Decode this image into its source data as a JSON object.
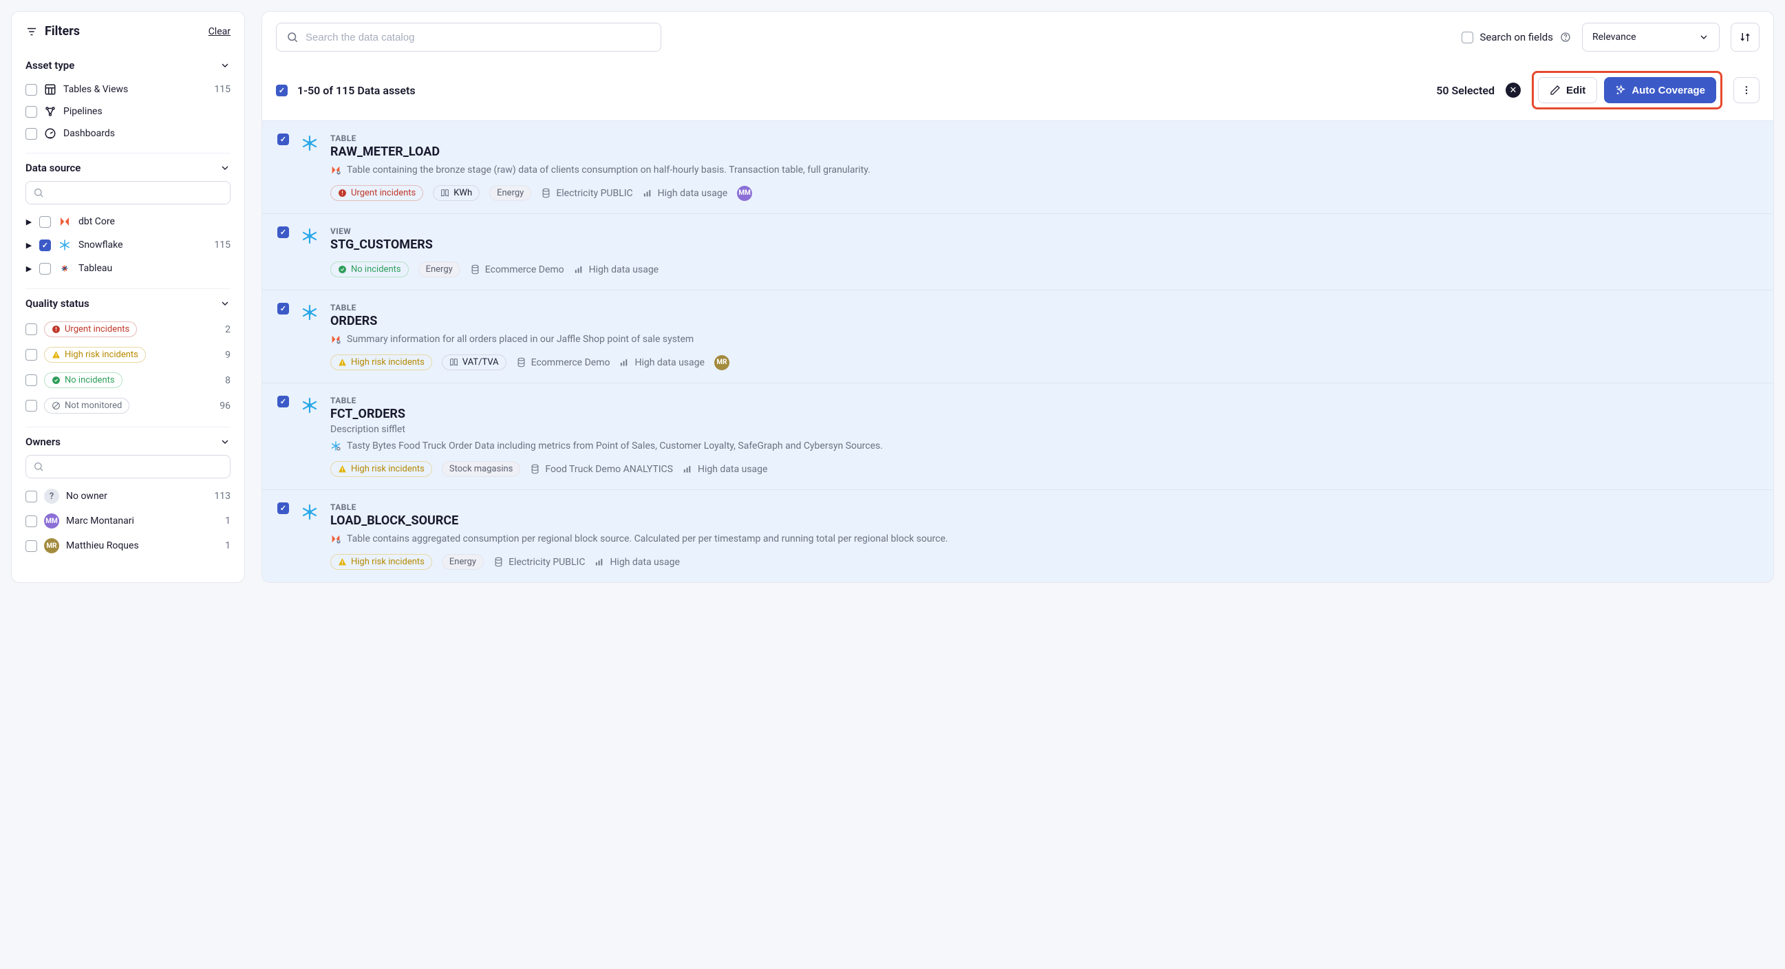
{
  "sidebar": {
    "title": "Filters",
    "clear": "Clear",
    "assetType": {
      "header": "Asset type",
      "tables": {
        "label": "Tables & Views",
        "count": "115"
      },
      "pipelines": {
        "label": "Pipelines"
      },
      "dashboards": {
        "label": "Dashboards"
      }
    },
    "dataSource": {
      "header": "Data source",
      "dbt": {
        "label": "dbt Core"
      },
      "snowflake": {
        "label": "Snowflake",
        "count": "115"
      },
      "tableau": {
        "label": "Tableau"
      }
    },
    "quality": {
      "header": "Quality status",
      "urgent": {
        "label": "Urgent incidents",
        "count": "2"
      },
      "high": {
        "label": "High risk incidents",
        "count": "9"
      },
      "none": {
        "label": "No incidents",
        "count": "8"
      },
      "notmon": {
        "label": "Not monitored",
        "count": "96"
      }
    },
    "owners": {
      "header": "Owners",
      "noOwner": {
        "label": "No owner",
        "count": "113"
      },
      "marc": {
        "label": "Marc Montanari",
        "initials": "MM",
        "count": "1"
      },
      "matthieu": {
        "label": "Matthieu Roques",
        "initials": "MR",
        "count": "1"
      }
    }
  },
  "topbar": {
    "searchPlaceholder": "Search the data catalog",
    "searchOnFields": "Search on fields",
    "sortLabel": "Relevance"
  },
  "selection": {
    "range": "1-50 of 115 Data assets",
    "countText": "50 Selected",
    "edit": "Edit",
    "autoCoverage": "Auto Coverage"
  },
  "assets": [
    {
      "kind": "TABLE",
      "name": "RAW_METER_LOAD",
      "description": "Table containing the bronze stage (raw) data of clients consumption on half-hourly basis. Transaction table, full granularity.",
      "showDbtDesc": true,
      "status": {
        "type": "urgent",
        "label": "Urgent incidents"
      },
      "domainTag": "KWh",
      "grayTag": "Energy",
      "location": "Electricity PUBLIC",
      "usage": "High data usage",
      "owner": {
        "initials": "MM",
        "color": "purple"
      }
    },
    {
      "kind": "VIEW",
      "name": "STG_CUSTOMERS",
      "status": {
        "type": "none",
        "label": "No incidents"
      },
      "grayTag": "Energy",
      "location": "Ecommerce Demo",
      "usage": "High data usage"
    },
    {
      "kind": "TABLE",
      "name": "ORDERS",
      "description": "Summary information for all orders placed in our Jaffle Shop point of sale system",
      "showDbtDesc": true,
      "status": {
        "type": "high",
        "label": "High risk incidents"
      },
      "domainTag": "VAT/TVA",
      "location": "Ecommerce Demo",
      "usage": "High data usage",
      "owner": {
        "initials": "MR",
        "color": "olive"
      }
    },
    {
      "kind": "TABLE",
      "name": "FCT_ORDERS",
      "subtitle": "Description sifflet",
      "description": "Tasty Bytes Food Truck Order Data including metrics from Point of Sales, Customer Loyalty, SafeGraph and Cybersyn Sources.",
      "showSfDesc": true,
      "status": {
        "type": "high",
        "label": "High risk incidents"
      },
      "grayTag": "Stock magasins",
      "location": "Food Truck Demo ANALYTICS",
      "usage": "High data usage"
    },
    {
      "kind": "TABLE",
      "name": "LOAD_BLOCK_SOURCE",
      "description": "Table contains aggregated consumption per regional block source. Calculated per per timestamp and running total per regional block source.",
      "showDbtDesc": true,
      "status": {
        "type": "high",
        "label": "High risk incidents"
      },
      "grayTag": "Energy",
      "location": "Electricity PUBLIC",
      "usage": "High data usage"
    }
  ]
}
